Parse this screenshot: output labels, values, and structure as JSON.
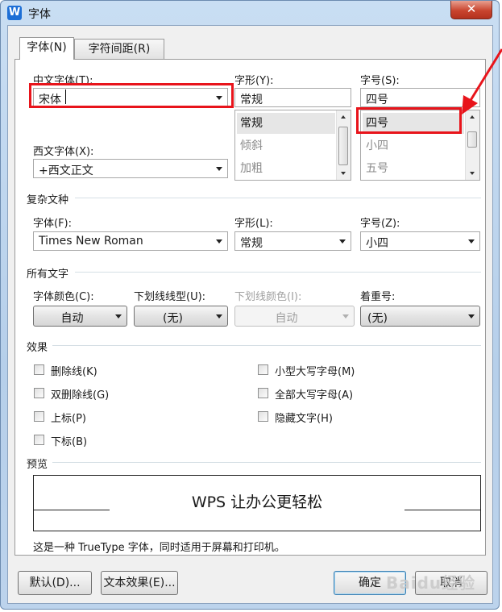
{
  "window": {
    "title": "字体",
    "app_icon": "W",
    "close": "✕"
  },
  "tabs": [
    {
      "label": "字体(N)",
      "active": true
    },
    {
      "label": "字符间距(R)",
      "active": false
    }
  ],
  "chinese_font": {
    "label": "中文字体(T):",
    "value": "宋体"
  },
  "style": {
    "label": "字形(Y):",
    "value": "常规",
    "options": [
      "常规",
      "倾斜",
      "加粗"
    ]
  },
  "size": {
    "label": "字号(S):",
    "value": "四号",
    "options": [
      "四号",
      "小四",
      "五号"
    ]
  },
  "western_font": {
    "label": "西文字体(X):",
    "value": "+西文正文"
  },
  "complex": {
    "section": "复杂文种",
    "font_label": "字体(F):",
    "font_value": "Times New Roman",
    "style_label": "字形(L):",
    "style_value": "常规",
    "size_label": "字号(Z):",
    "size_value": "小四"
  },
  "all_text": {
    "section": "所有文字",
    "color_label": "字体颜色(C):",
    "color_value": "自动",
    "underline_label": "下划线线型(U):",
    "underline_value": "(无)",
    "underline_color_label": "下划线颜色(I):",
    "underline_color_value": "自动",
    "emphasis_label": "着重号:",
    "emphasis_value": "(无)"
  },
  "effects": {
    "section": "效果",
    "items": [
      {
        "label": "删除线(K)"
      },
      {
        "label": "双删除线(G)"
      },
      {
        "label": "上标(P)"
      },
      {
        "label": "下标(B)"
      },
      {
        "label": "小型大写字母(M)"
      },
      {
        "label": "全部大写字母(A)"
      },
      {
        "label": "隐藏文字(H)"
      }
    ]
  },
  "preview": {
    "section": "预览",
    "text": "WPS 让办公更轻松"
  },
  "info": "这是一种 TrueType 字体，同时适用于屏幕和打印机。",
  "buttons": {
    "default": "默认(D)...",
    "text_effect": "文本效果(E)...",
    "ok": "确定",
    "cancel": "取消"
  },
  "watermark": "Baidu经验",
  "colors": {
    "highlight": "#e8141b",
    "window_frame": "#b6cfea"
  }
}
